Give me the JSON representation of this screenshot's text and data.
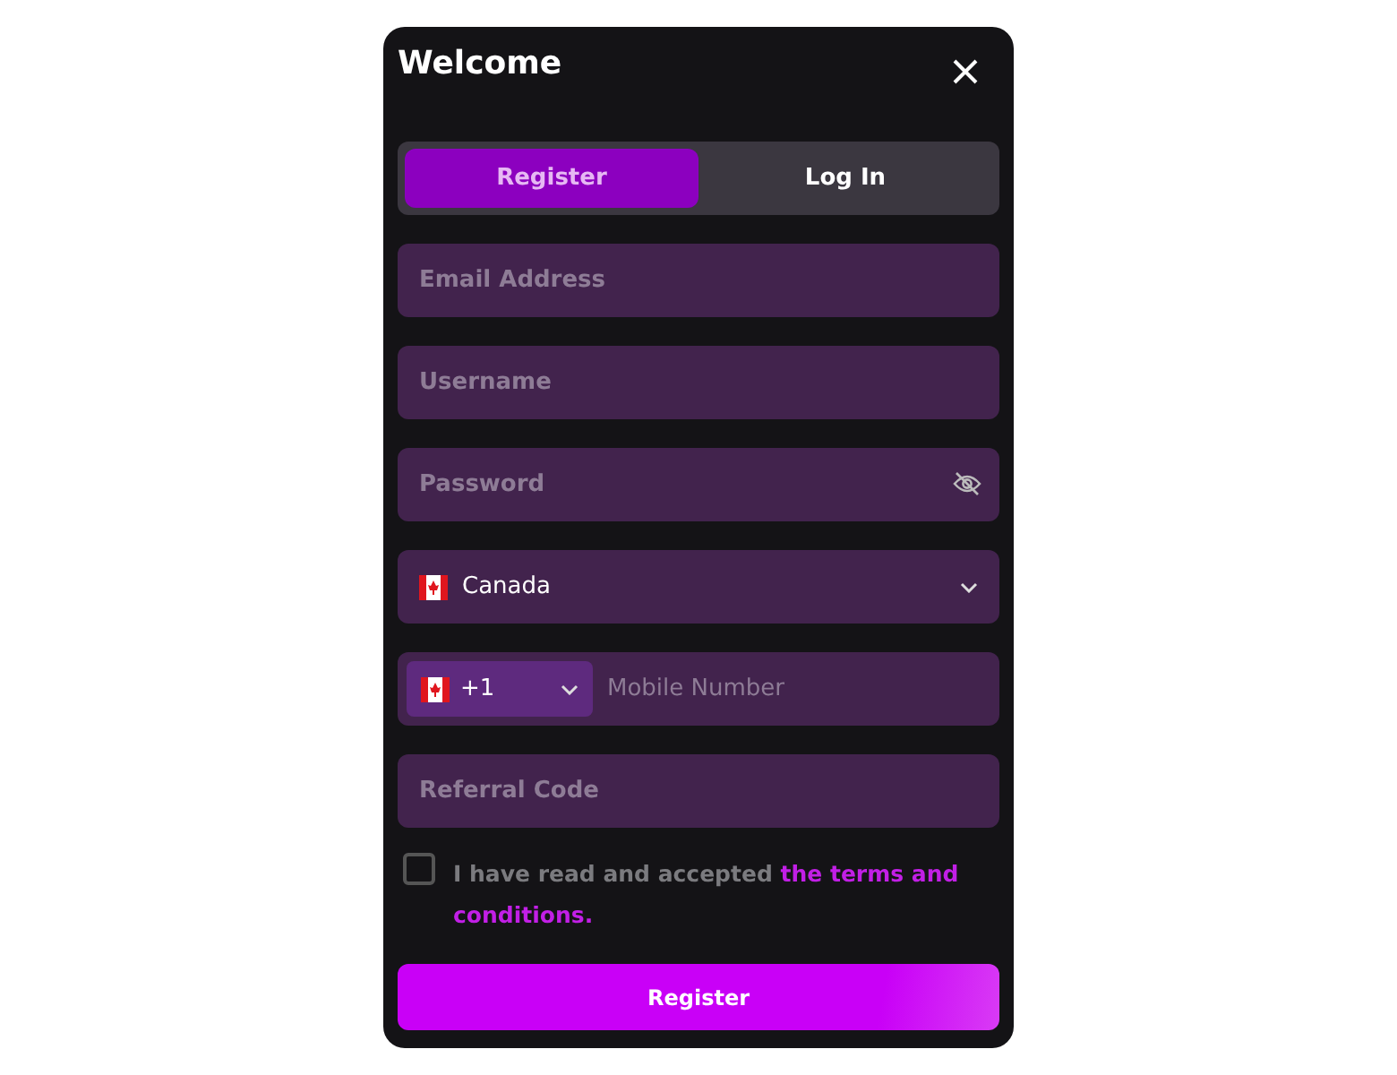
{
  "dialog": {
    "title": "Welcome"
  },
  "tabs": [
    {
      "label": "Register",
      "selected": true
    },
    {
      "label": "Log In",
      "selected": false
    }
  ],
  "fields": [
    {
      "kind": "text",
      "placeholder": "Email Address"
    },
    {
      "kind": "text",
      "placeholder": "Username"
    },
    {
      "kind": "password",
      "placeholder": "Password"
    },
    {
      "kind": "country",
      "value": "Canada"
    },
    {
      "kind": "phone",
      "code": "+1",
      "placeholder": "Mobile Number"
    },
    {
      "kind": "text",
      "placeholder": "Referral Code"
    }
  ],
  "terms": {
    "checked": false,
    "text": "I have read and accepted",
    "link_lines": [
      "the terms and",
      "conditions."
    ]
  },
  "submit": "Register"
}
